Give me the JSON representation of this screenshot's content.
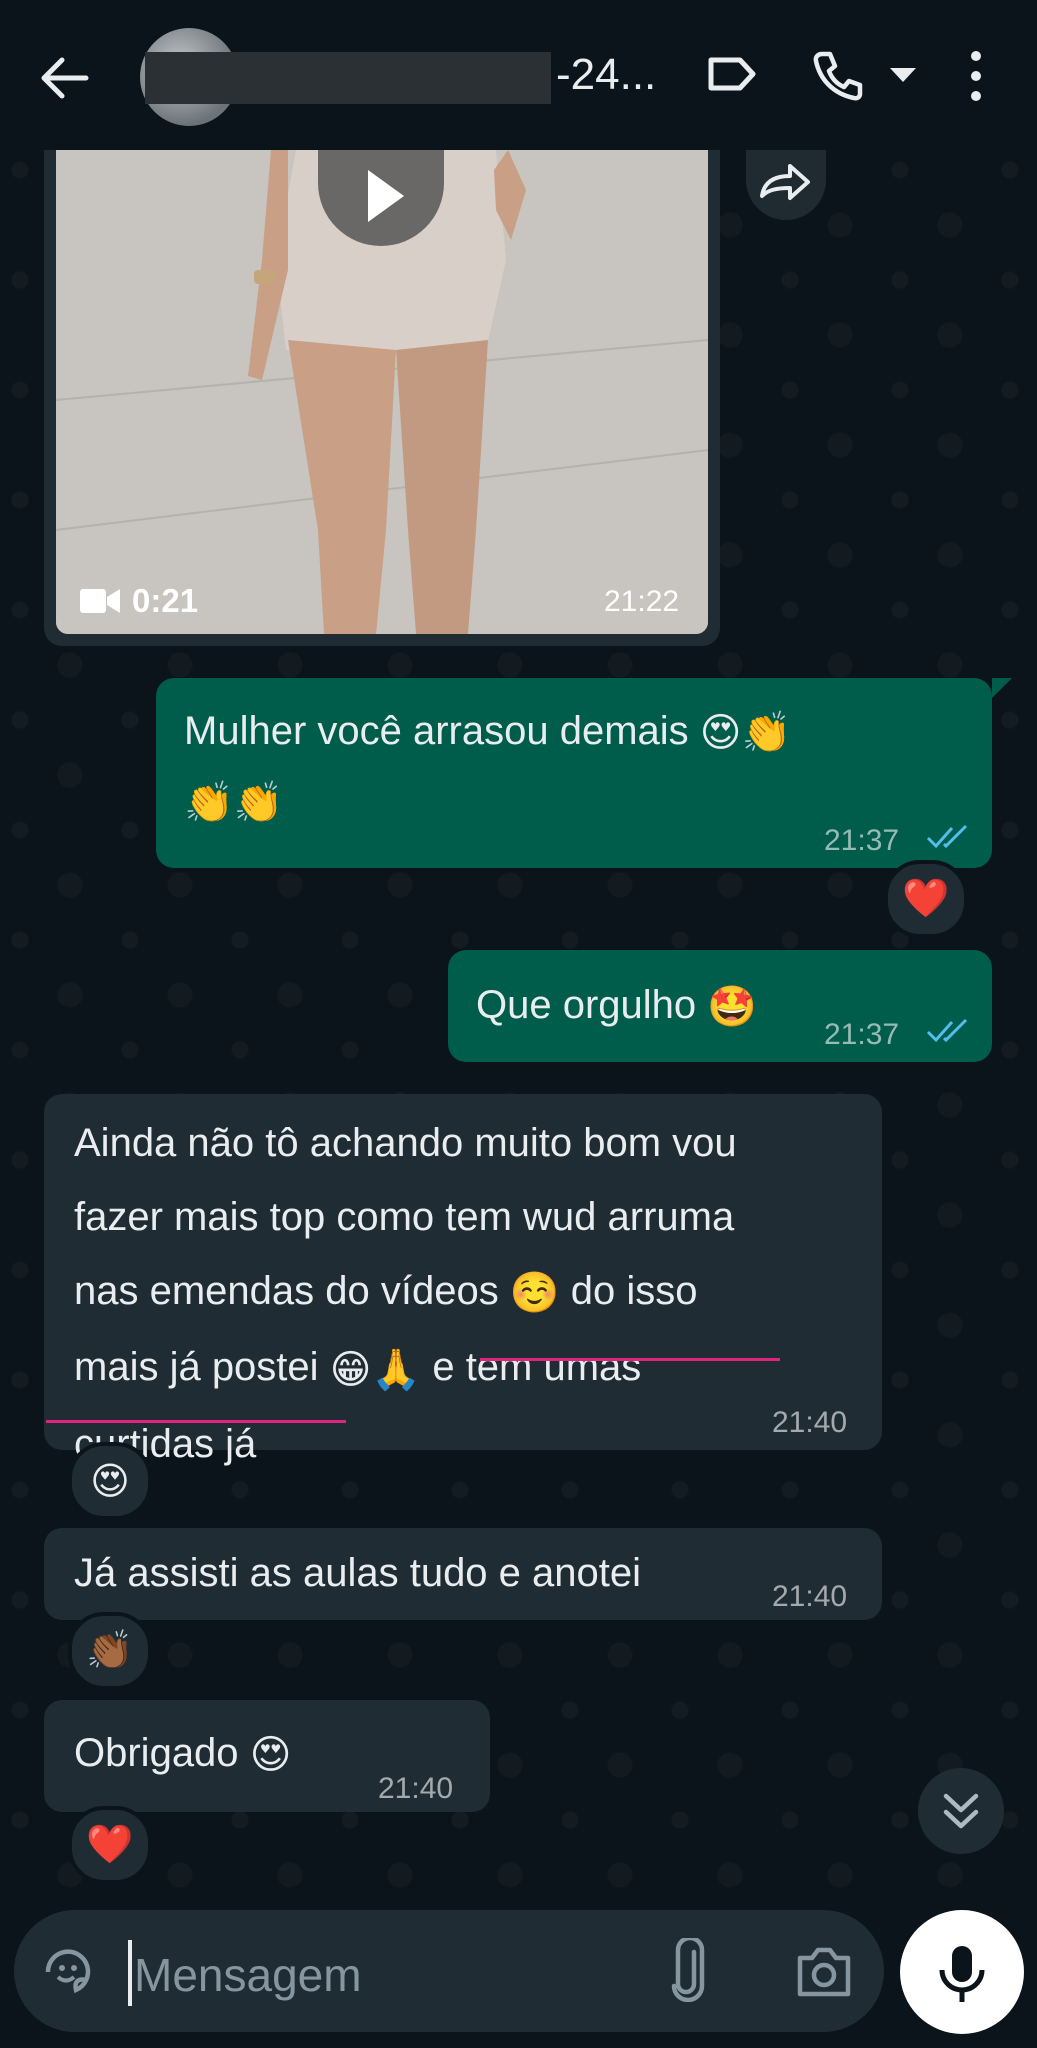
{
  "header": {
    "contact_name_suffix": "-24...",
    "icons": [
      "back-arrow-icon",
      "avatar",
      "label-icon",
      "phone-icon",
      "caret-down-icon",
      "more-vert-icon"
    ]
  },
  "messages": [
    {
      "type": "video",
      "direction": "in",
      "duration": "0:21",
      "time": "21:22"
    },
    {
      "type": "text",
      "direction": "out",
      "text": "Mulher você arrasou demais",
      "time": "21:37",
      "reaction": "❤️"
    },
    {
      "type": "text",
      "direction": "out",
      "text": "Que orgulho",
      "time": "21:37"
    },
    {
      "type": "text",
      "direction": "in",
      "lines": [
        "Ainda não tô achando muito bom vou",
        "fazer mais top como tem wud arruma",
        "nas emendas do vídeos",
        "do isso",
        "mais já postei",
        "e tem umas",
        "curtidas já"
      ],
      "time": "21:40",
      "reaction": "😍"
    },
    {
      "type": "text",
      "direction": "in",
      "text": "Já assisti as aulas tudo e anotei",
      "time": "21:40",
      "reaction": "👏🏾"
    },
    {
      "type": "text",
      "direction": "in",
      "text": "Obrigado",
      "time": "21:40",
      "reaction": "❤️"
    }
  ],
  "composer": {
    "placeholder": "Mensagem"
  },
  "colors": {
    "background": "#0b141a",
    "outgoing_bubble": "#005c4b",
    "incoming_bubble": "#202c33",
    "read_ticks": "#53bdeb"
  }
}
